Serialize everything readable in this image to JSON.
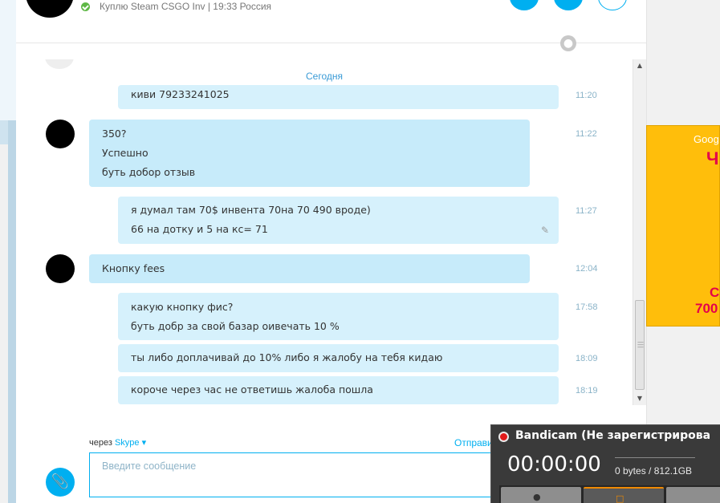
{
  "contact": {
    "status_text": "Куплю Steam CSGO Inv  |  19:33 Россия"
  },
  "conversation": {
    "date_separator": "Сегодня",
    "messages": [
      {
        "lines": [
          "киви 79233241025"
        ],
        "time": "11:20"
      },
      {
        "lines": [
          "350?",
          "Успешно",
          "буть добор отзыв"
        ],
        "time": "11:22"
      },
      {
        "lines": [
          "я думал там 70$ инвента 70на 70 490 вроде)",
          "66 на дотку и 5 на кс= 71"
        ],
        "time": "11:27"
      },
      {
        "lines": [
          "Кнопку fees"
        ],
        "time": "12:04"
      },
      {
        "lines": [
          "какую кнопку фис?",
          "буть добр за свой базар оивечать 10 %"
        ],
        "time": "17:58"
      },
      {
        "lines": [
          "ты либо доплачивай до 10% либо я жалобу на тебя кидаю"
        ],
        "time": "18:09"
      },
      {
        "lines": [
          "короче через час не ответишь жалоба пошла"
        ],
        "time": "18:19"
      }
    ]
  },
  "composer": {
    "via_label": "через",
    "via_service": "Skype",
    "send_link": "Отправи",
    "placeholder": "Введите сообщение"
  },
  "ad": {
    "brand": "Goog",
    "headline": "Ч",
    "line1": "С",
    "line2": "700"
  },
  "bandicam": {
    "title": "Bandicam (Не зарегистрирова",
    "timer": "00:00:00",
    "size": "0 bytes / 812.1GB"
  },
  "colors": {
    "accent": "#00aff0",
    "bubble": "#c7ebfa",
    "ad_background": "#ffbe0b",
    "ad_text": "#e4004b",
    "online": "#5fb846"
  }
}
